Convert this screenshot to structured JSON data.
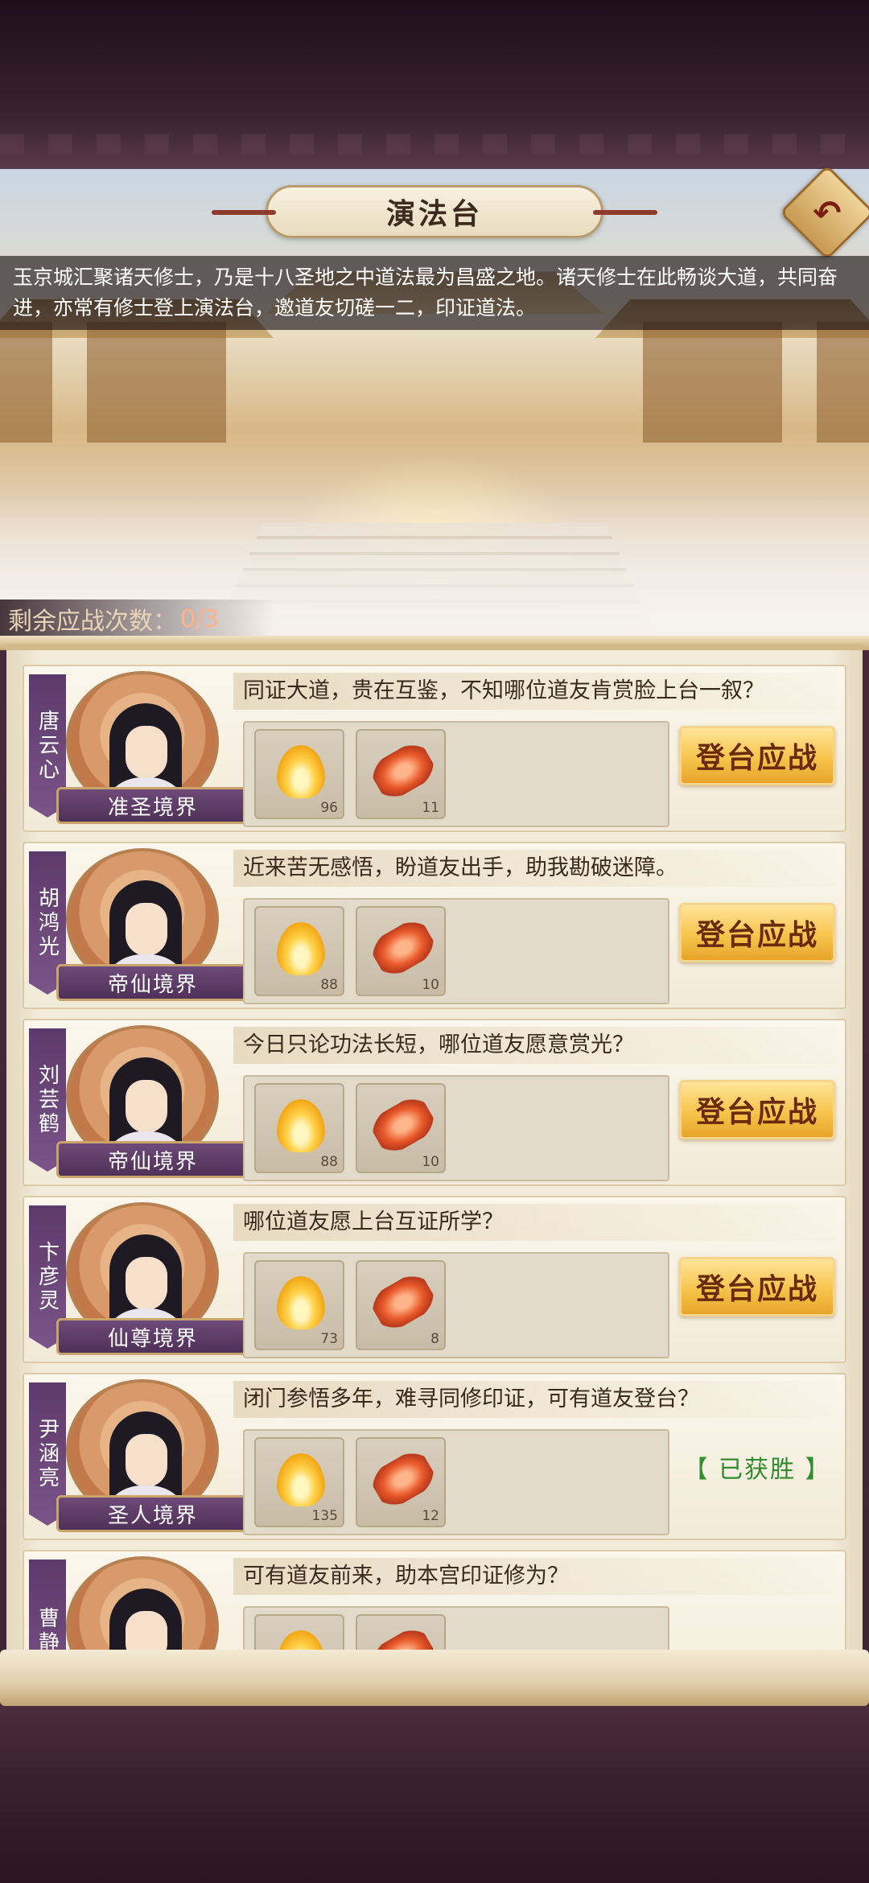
{
  "header": {
    "title": "演法台",
    "back_icon": "back-arrow-icon",
    "intro": "玉京城汇聚诸天修士，乃是十八圣地之中道法最为昌盛之地。诸天修士在此畅谈大道，共同奋进，亦常有修士登上演法台，邀道友切磋一二，印证道法。"
  },
  "remaining": {
    "label": "剩余应战次数：",
    "value": "0/3"
  },
  "challengers": [
    {
      "name": "唐云心",
      "realm": "准圣境界",
      "quote": "同证大道，贵在互鉴，不知哪位道友肯赏脸上台一叙？",
      "rewards": [
        {
          "icon": "golden-flame-icon",
          "qty": "96"
        },
        {
          "icon": "red-scroll-icon",
          "qty": "11"
        }
      ],
      "action": "登台应战"
    },
    {
      "name": "胡鸿光",
      "realm": "帝仙境界",
      "quote": "近来苦无感悟，盼道友出手，助我勘破迷障。",
      "rewards": [
        {
          "icon": "golden-flame-icon",
          "qty": "88"
        },
        {
          "icon": "red-scroll-icon",
          "qty": "10"
        }
      ],
      "action": "登台应战"
    },
    {
      "name": "刘芸鹤",
      "realm": "帝仙境界",
      "quote": "今日只论功法长短，哪位道友愿意赏光？",
      "rewards": [
        {
          "icon": "golden-flame-icon",
          "qty": "88"
        },
        {
          "icon": "red-scroll-icon",
          "qty": "10"
        }
      ],
      "action": "登台应战"
    },
    {
      "name": "卞彦灵",
      "realm": "仙尊境界",
      "quote": "哪位道友愿上台互证所学？",
      "rewards": [
        {
          "icon": "golden-flame-icon",
          "qty": "73"
        },
        {
          "icon": "red-scroll-icon",
          "qty": "8"
        }
      ],
      "action": "登台应战"
    },
    {
      "name": "尹涵亮",
      "realm": "圣人境界",
      "quote": "闭门参悟多年，难寻同修印证，可有道友登台？",
      "rewards": [
        {
          "icon": "golden-flame-icon",
          "qty": "135"
        },
        {
          "icon": "red-scroll-icon",
          "qty": "12"
        }
      ],
      "status": "【 已获胜 】"
    },
    {
      "name": "曹静",
      "quote": "可有道友前来，助本宫印证修为？"
    }
  ],
  "colors": {
    "button": "#f7c44c",
    "won": "#2f8d2f",
    "realm_plate": "#6e4a78"
  }
}
